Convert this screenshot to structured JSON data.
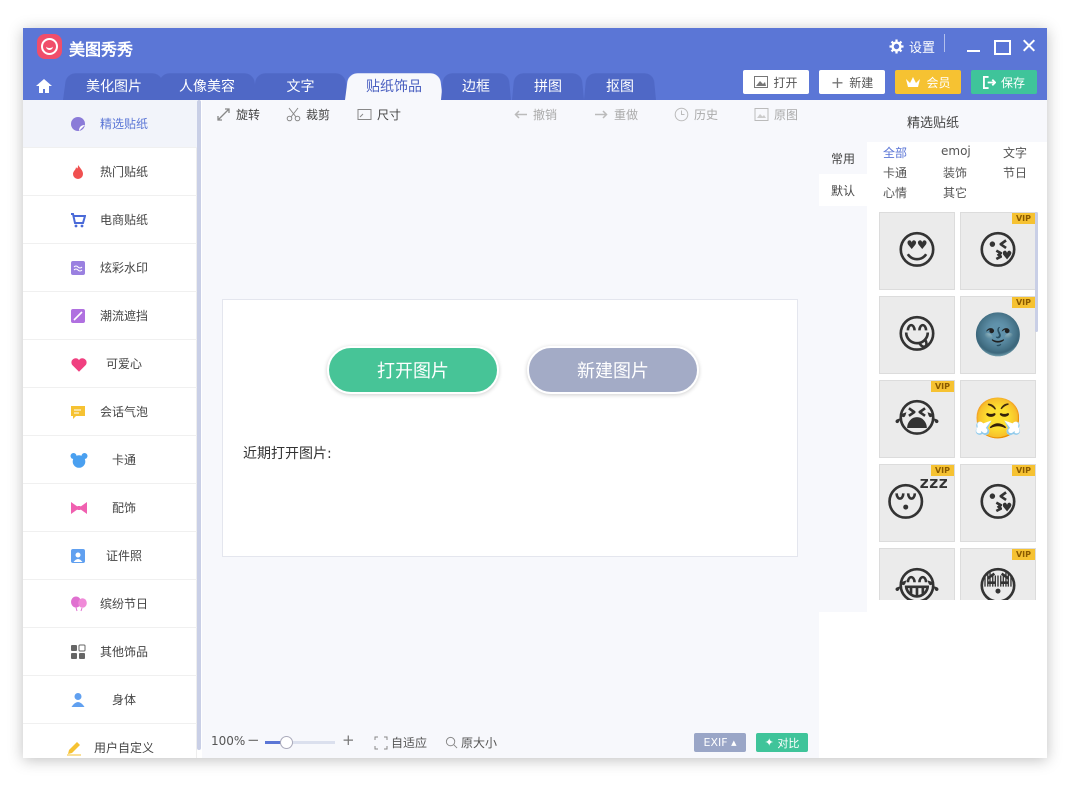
{
  "app": {
    "title": "美图秀秀",
    "settings_label": "设置"
  },
  "tabs": [
    "美化图片",
    "人像美容",
    "文字",
    "贴纸饰品",
    "边框",
    "拼图",
    "抠图"
  ],
  "active_tab": "贴纸饰品",
  "top_buttons": {
    "open": "打开",
    "new": "新建",
    "vip": "会员",
    "save": "保存"
  },
  "sidebar": {
    "items": [
      {
        "label": "精选贴纸",
        "icon": "sticker-icon",
        "color": "#8b7bd8"
      },
      {
        "label": "热门贴纸",
        "icon": "flame-icon",
        "color": "#f05050"
      },
      {
        "label": "电商贴纸",
        "icon": "cart-icon",
        "color": "#4a6ad8"
      },
      {
        "label": "炫彩水印",
        "icon": "watermark-icon",
        "color": "#9a80e0"
      },
      {
        "label": "潮流遮挡",
        "icon": "mask-icon",
        "color": "#b070e0"
      },
      {
        "label": "可爱心",
        "icon": "heart-icon",
        "color": "#f04080"
      },
      {
        "label": "会话气泡",
        "icon": "bubble-icon",
        "color": "#f6c232"
      },
      {
        "label": "卡通",
        "icon": "bear-icon",
        "color": "#4aa0f0"
      },
      {
        "label": "配饰",
        "icon": "bow-icon",
        "color": "#f060b0"
      },
      {
        "label": "证件照",
        "icon": "id-photo-icon",
        "color": "#60a0f0"
      },
      {
        "label": "缤纷节日",
        "icon": "balloon-icon",
        "color": "#e070d0"
      },
      {
        "label": "其他饰品",
        "icon": "grid-icon",
        "color": "#666666"
      },
      {
        "label": "身体",
        "icon": "person-icon",
        "color": "#60a0f0"
      },
      {
        "label": "用户自定义",
        "icon": "pen-icon",
        "color": "#f6c232"
      }
    ]
  },
  "toolbar": {
    "rotate": "旋转",
    "crop": "裁剪",
    "size": "尺寸",
    "undo": "撤销",
    "redo": "重做",
    "history": "历史",
    "original": "原图"
  },
  "main": {
    "open_picture": "打开图片",
    "new_picture": "新建图片",
    "recent_label": "近期打开图片:"
  },
  "status": {
    "zoom": "100%",
    "zoom_level": 0.3,
    "fit": "自适应",
    "actual_size": "原大小",
    "exif": "EXIF",
    "compare": "对比"
  },
  "right_panel": {
    "title": "精选贴纸",
    "categories": [
      "常用",
      "默认"
    ],
    "filters": [
      "全部",
      "emoj",
      "文字",
      "卡通",
      "装饰",
      "节日",
      "心情",
      "其它"
    ],
    "vip_label": "VIP",
    "stickers": [
      {
        "emoji": "😍",
        "vip": false
      },
      {
        "emoji": "😘",
        "vip": true
      },
      {
        "emoji": "😋",
        "vip": false
      },
      {
        "emoji": "🌚",
        "vip": true
      },
      {
        "emoji": "😭",
        "vip": true
      },
      {
        "emoji": "😤",
        "vip": false
      },
      {
        "emoji": "😴",
        "vip": true
      },
      {
        "emoji": "😘",
        "vip": true
      },
      {
        "emoji": "😂",
        "vip": false
      },
      {
        "emoji": "😳",
        "vip": true
      }
    ]
  }
}
